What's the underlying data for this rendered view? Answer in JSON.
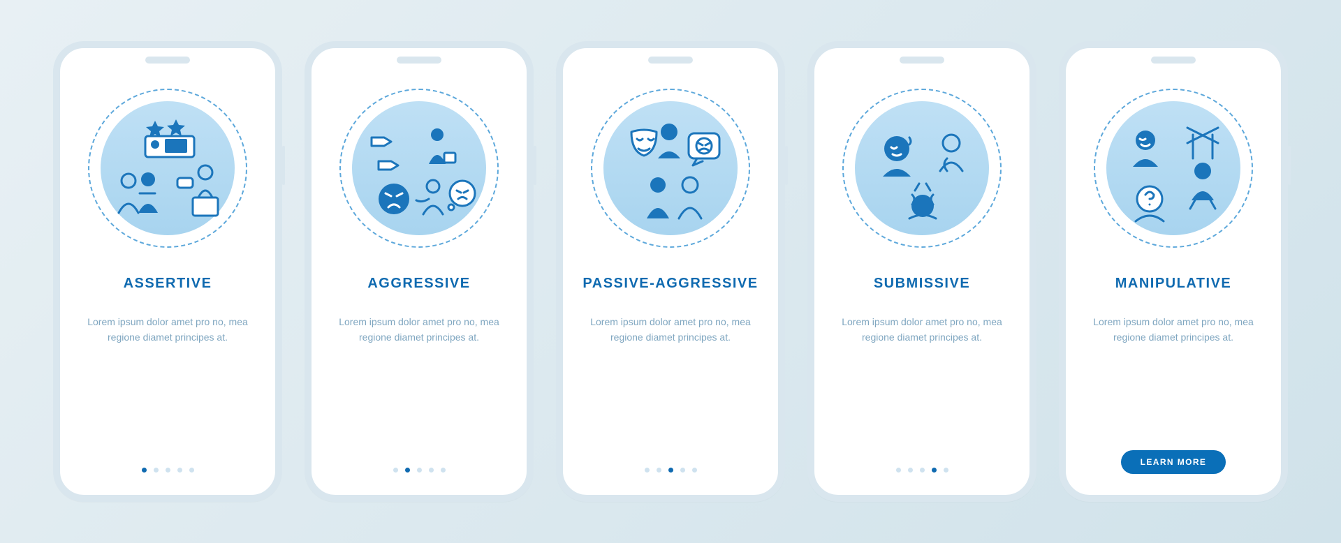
{
  "meta": {
    "description": "Communication styles — five-screen mobile onboarding template in blue line-art style.",
    "icon_style": "blue line icons on soft blue circular disc with dashed circle border",
    "palette": {
      "accent": "#0f6ab0",
      "accent_soft": "#5da8db",
      "muted": "#9bb8cf",
      "background": "#e8f0f4",
      "phone": "#ffffff",
      "frame": "#d9e6ee",
      "pill": "#0a6fb8"
    }
  },
  "placeholder_body": "Lorem ipsum dolor amet pro no, mea regione diamet principes at.",
  "cta_label": "LEARN MORE",
  "screens": [
    {
      "id": "assertive",
      "title": "ASSERTIVE",
      "icon": "assertive-icon",
      "icon_semantics": "two people shaking hands / presenting; stars above; speech bubble; podium",
      "active_index": 0,
      "cta": false
    },
    {
      "id": "aggressive",
      "title": "AGGRESSIVE",
      "icon": "aggressive-icon",
      "icon_semantics": "pointing hands; briefcase person; angry shouting face; grabbing figure; angry-thought bubble",
      "active_index": 1,
      "cta": false
    },
    {
      "id": "passive-aggressive",
      "title": "PASSIVE-AGGRESSIVE",
      "icon": "passive-aggressive-icon",
      "icon_semantics": "theater mask held by a person; angry-face speech bubble; two silhouettes talking",
      "active_index": 2,
      "cta": false
    },
    {
      "id": "submissive",
      "title": "SUBMISSIVE",
      "icon": "submissive-icon",
      "icon_semantics": "sweating anxious person; figure curled up; head-in-hands with stress bolts",
      "active_index": 3,
      "cta": false
    },
    {
      "id": "manipulative",
      "title": "MANIPULATIVE",
      "icon": "manipulative-icon",
      "icon_semantics": "smiling person; figure with question-mark face; marionette on strings from a control bar",
      "active_index": 4,
      "cta": true
    }
  ]
}
